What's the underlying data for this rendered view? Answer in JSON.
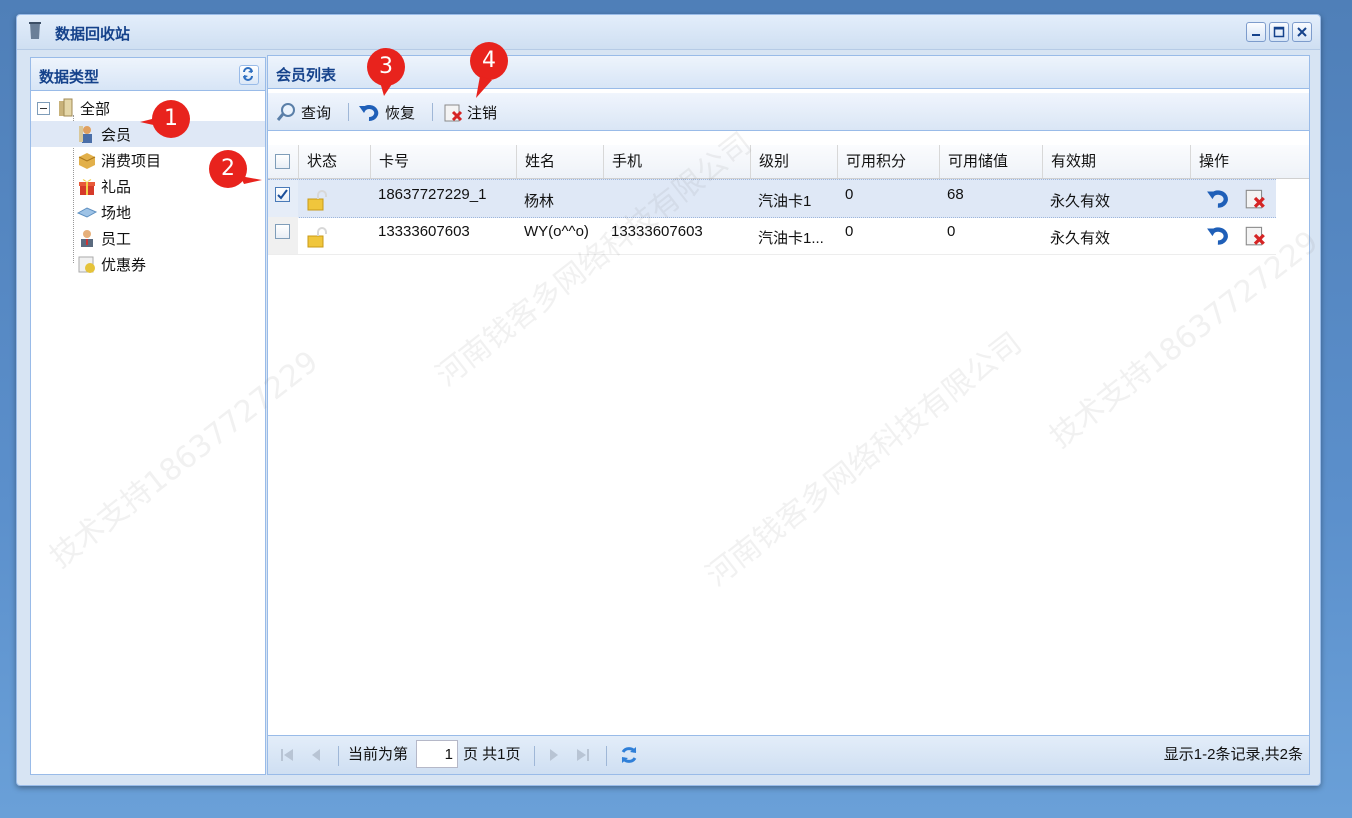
{
  "window": {
    "title": "数据回收站"
  },
  "left_panel": {
    "title": "数据类型",
    "tree": {
      "root": "全部",
      "children": [
        "会员",
        "消费项目",
        "礼品",
        "场地",
        "员工",
        "优惠券"
      ]
    }
  },
  "right_panel": {
    "title": "会员列表",
    "toolbar": {
      "query": "查询",
      "restore": "恢复",
      "cancel": "注销"
    },
    "columns": [
      "状态",
      "卡号",
      "姓名",
      "手机",
      "级别",
      "可用积分",
      "可用储值",
      "有效期",
      "操作"
    ],
    "rows": [
      {
        "checked": true,
        "card": "18637727229_1",
        "name": "杨林",
        "phone": "",
        "level": "汽油卡1",
        "points": "0",
        "balance": "68",
        "expiry": "永久有效"
      },
      {
        "checked": false,
        "card": "13333607603",
        "name": "WY(o^^o)",
        "phone": "13333607603",
        "level": "汽油卡1...",
        "points": "0",
        "balance": "0",
        "expiry": "永久有效"
      }
    ],
    "pager": {
      "current_label": "当前为第",
      "page": "1",
      "total_label": "页 共1页",
      "summary": "显示1-2条记录,共2条"
    }
  },
  "callouts": [
    "1",
    "2",
    "3",
    "4"
  ],
  "watermark": {
    "company": "河南钱客多网络科技有限公司",
    "support": "技术支持18637727229"
  },
  "colors": {
    "callout": "#e8231d",
    "header_text": "#15428b",
    "selected_row": "#dfe8f6"
  }
}
